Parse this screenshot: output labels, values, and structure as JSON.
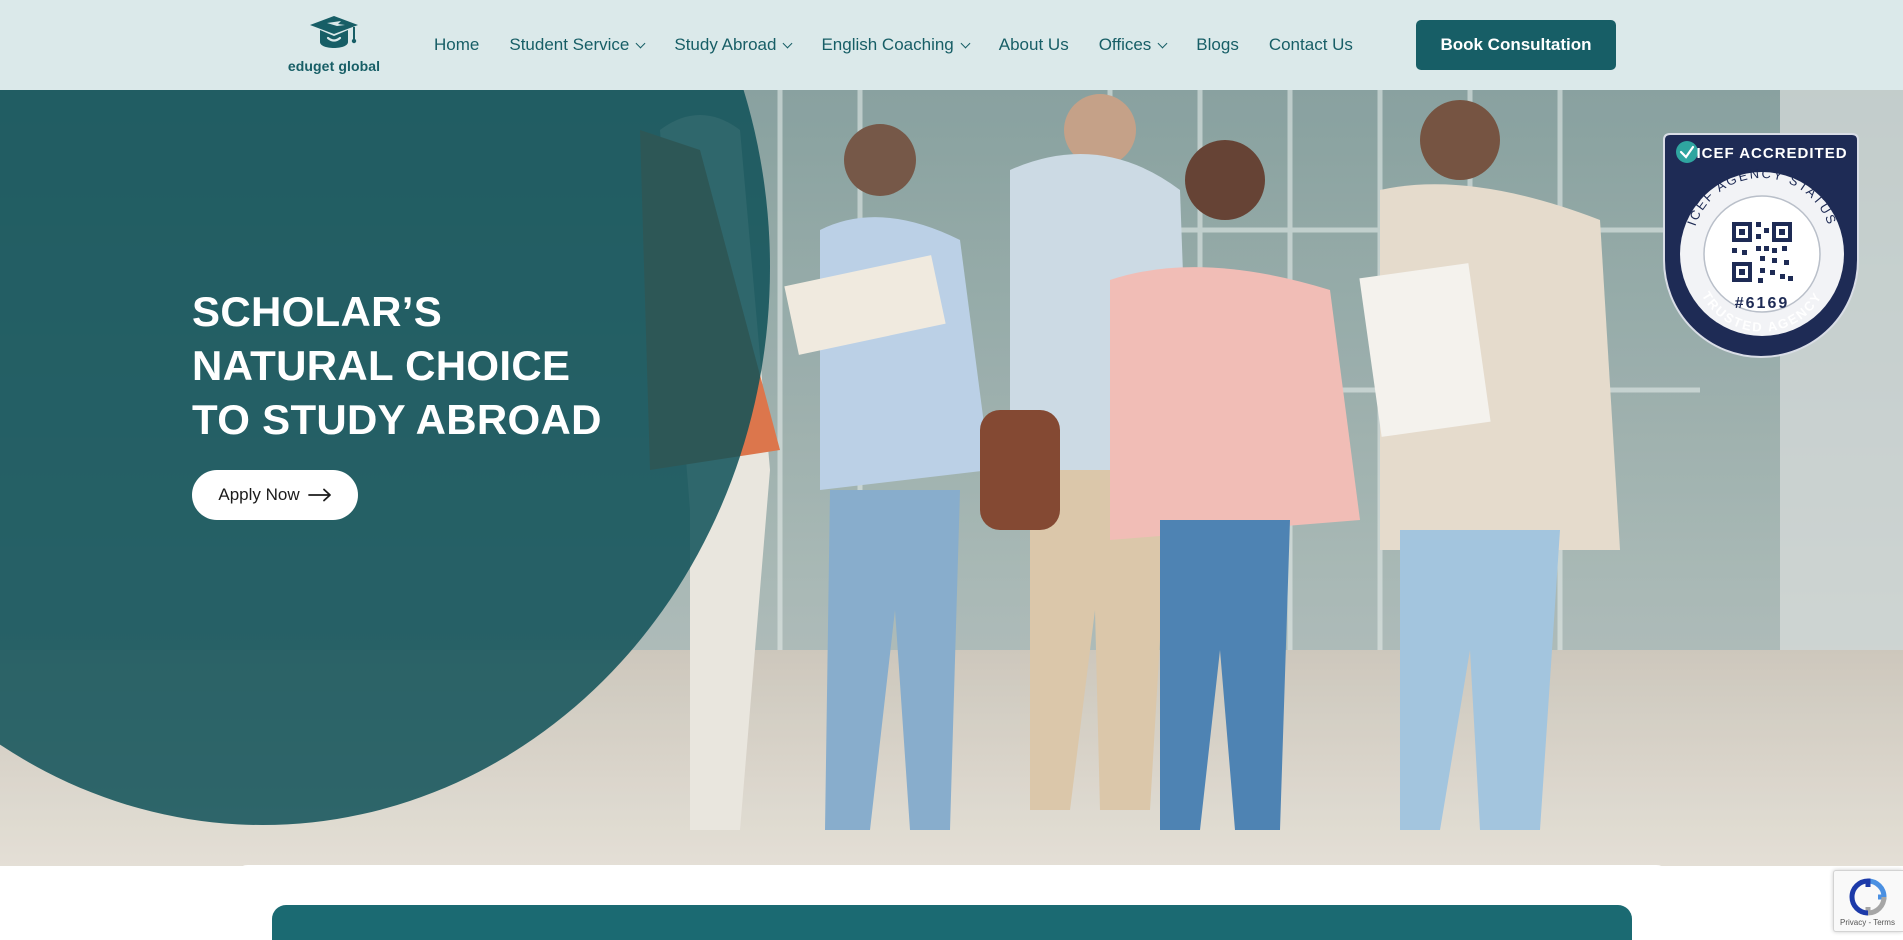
{
  "brand": {
    "name": "eduget global",
    "logo_icon": "graduation-cap-icon",
    "color": "#175e66"
  },
  "nav": {
    "items": [
      {
        "label": "Home",
        "dropdown": false
      },
      {
        "label": "Student Service",
        "dropdown": true
      },
      {
        "label": "Study Abroad",
        "dropdown": true
      },
      {
        "label": "English Coaching",
        "dropdown": true
      },
      {
        "label": "About Us",
        "dropdown": false
      },
      {
        "label": "Offices",
        "dropdown": true
      },
      {
        "label": "Blogs",
        "dropdown": false
      },
      {
        "label": "Contact Us",
        "dropdown": false
      }
    ],
    "cta_label": "Book Consultation"
  },
  "hero": {
    "headline": [
      "SCHOLAR’S",
      "NATURAL CHOICE",
      "TO STUDY ABROAD"
    ],
    "apply_label": "Apply Now",
    "apply_icon": "arrow-right-icon"
  },
  "badge": {
    "top_text": "ICEF ACCREDITED",
    "ring_top": "ICEF AGENCY STATUS",
    "number": "#6169",
    "ring_bottom": "TRUSTED AGENCY"
  },
  "recaptcha": {
    "text": "Privacy - Terms"
  },
  "colors": {
    "header_bg": "#dbe9ea",
    "teal": "#175e66",
    "badge_navy": "#1e2b55"
  }
}
